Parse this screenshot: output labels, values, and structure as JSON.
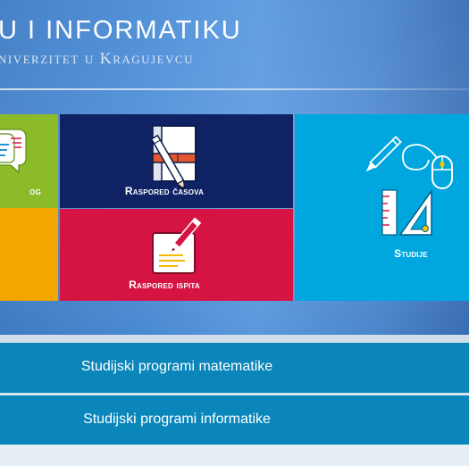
{
  "header": {
    "title_line1": "U I INFORMATIKU",
    "title_line2": "niverzitet u Kragujevcu"
  },
  "tiles": {
    "blog": {
      "label": "og",
      "icon": "chat-bubbles-icon",
      "color": "#8cbb2a"
    },
    "orange": {
      "color": "#f4a600"
    },
    "raspored_casova": {
      "label": "Raspored časova",
      "icon": "notebook-pencil-icon",
      "color": "#0f2364"
    },
    "raspored_ispita": {
      "label": "Raspored ispita",
      "icon": "exam-paper-pencil-icon",
      "color": "#d61443"
    },
    "studije": {
      "label": "Studije",
      "icon": "study-tools-icon",
      "color": "#00a7de"
    }
  },
  "programs": [
    {
      "label": "Studijski programi matematike"
    },
    {
      "label": "Studijski programi informatike"
    }
  ],
  "colors": {
    "program_bar": "#0a86bb",
    "header_blue": "#4b8cd6"
  }
}
